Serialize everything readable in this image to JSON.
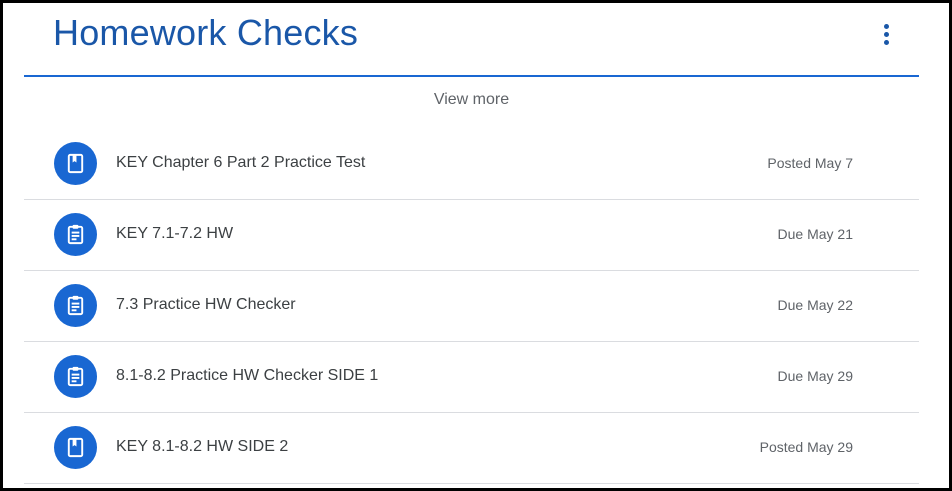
{
  "header": {
    "title": "Homework Checks"
  },
  "view_more_label": "View more",
  "items": [
    {
      "icon": "material-book-icon",
      "title": "KEY Chapter 6 Part 2 Practice Test",
      "date": "Posted May 7"
    },
    {
      "icon": "assignment-clipboard-icon",
      "title": "KEY 7.1-7.2 HW",
      "date": "Due May 21"
    },
    {
      "icon": "assignment-clipboard-icon",
      "title": "7.3 Practice HW Checker",
      "date": "Due May 22"
    },
    {
      "icon": "assignment-clipboard-icon",
      "title": "8.1-8.2 Practice HW Checker SIDE 1",
      "date": "Due May 29"
    },
    {
      "icon": "material-book-icon",
      "title": "KEY 8.1-8.2 HW SIDE 2",
      "date": "Posted May 29"
    }
  ],
  "colors": {
    "accent": "#1967d2",
    "title": "#1a57a8",
    "divider": "#dadce0",
    "frame": "#000000"
  }
}
